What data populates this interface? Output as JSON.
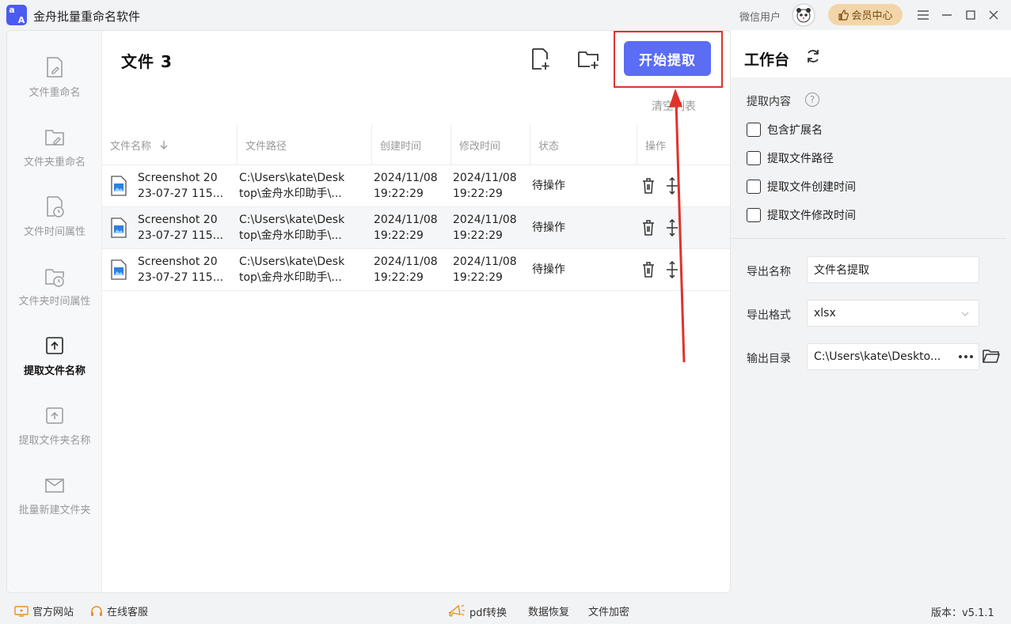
{
  "titlebar": {
    "app_title": "金舟批量重命名软件",
    "user_label": "微信用户",
    "vip_label": "会员中心"
  },
  "sidebar": {
    "items": [
      {
        "label": "文件重命名"
      },
      {
        "label": "文件夹重命名"
      },
      {
        "label": "文件时间属性"
      },
      {
        "label": "文件夹时间属性"
      },
      {
        "label": "提取文件名称"
      },
      {
        "label": "提取文件夹名称"
      },
      {
        "label": "批量新建文件夹"
      }
    ]
  },
  "content": {
    "files_title": "文件 3",
    "start_label": "开始提取",
    "clear_label": "清空列表"
  },
  "table": {
    "headers": {
      "name": "文件名称",
      "path": "文件路径",
      "created": "创建时间",
      "modified": "修改时间",
      "status": "状态",
      "ops": "操作"
    },
    "rows": [
      {
        "name1": "Screenshot 20",
        "name2": "23-07-27 115...",
        "path1": "C:\\Users\\kate\\Desk",
        "path2": "top\\金舟水印助手\\...",
        "c1": "2024/11/08",
        "c2": "19:22:29",
        "m1": "2024/11/08",
        "m2": "19:22:29",
        "status": "待操作"
      },
      {
        "name1": "Screenshot 20",
        "name2": "23-07-27 115...",
        "path1": "C:\\Users\\kate\\Desk",
        "path2": "top\\金舟水印助手\\...",
        "c1": "2024/11/08",
        "c2": "19:22:29",
        "m1": "2024/11/08",
        "m2": "19:22:29",
        "status": "待操作"
      },
      {
        "name1": "Screenshot 20",
        "name2": "23-07-27 115...",
        "path1": "C:\\Users\\kate\\Desk",
        "path2": "top\\金舟水印助手\\...",
        "c1": "2024/11/08",
        "c2": "19:22:29",
        "m1": "2024/11/08",
        "m2": "19:22:29",
        "status": "待操作"
      }
    ]
  },
  "workbench": {
    "title": "工作台",
    "section_label": "提取内容",
    "options": [
      {
        "label": "包含扩展名"
      },
      {
        "label": "提取文件路径"
      },
      {
        "label": "提取文件创建时间"
      },
      {
        "label": "提取文件修改时间"
      }
    ],
    "export_name_label": "导出名称",
    "export_name_value": "文件名提取",
    "export_format_label": "导出格式",
    "export_format_value": "xlsx",
    "output_dir_label": "输出目录",
    "output_dir_value": "C:\\Users\\kate\\Deskto..."
  },
  "footer": {
    "website": "官方网站",
    "support": "在线客服",
    "pdf": "pdf转换",
    "recovery": "数据恢复",
    "encrypt": "文件加密",
    "version": "版本：v5.1.1"
  },
  "colors": {
    "accent": "#5b6cf5",
    "annotation": "#e0322b",
    "vip": "#f2d6a9"
  }
}
